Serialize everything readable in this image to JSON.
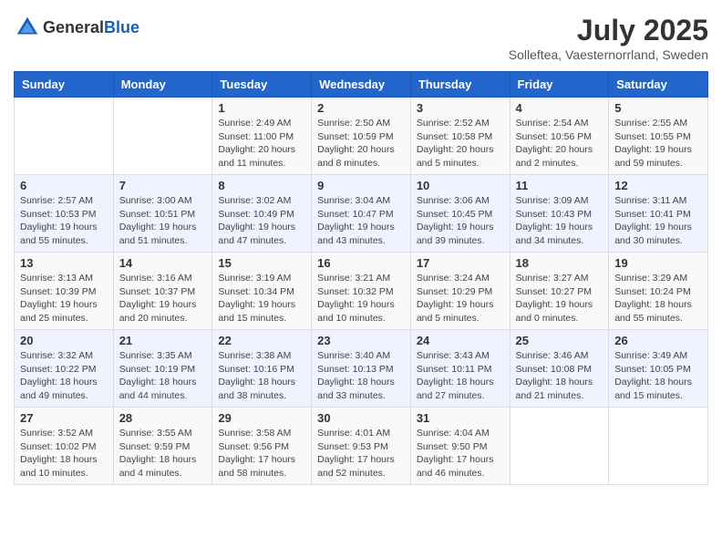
{
  "header": {
    "logo_general": "General",
    "logo_blue": "Blue",
    "month_year": "July 2025",
    "location": "Solleftea, Vaesternorrland, Sweden"
  },
  "weekdays": [
    "Sunday",
    "Monday",
    "Tuesday",
    "Wednesday",
    "Thursday",
    "Friday",
    "Saturday"
  ],
  "weeks": [
    [
      {
        "day": "",
        "info": ""
      },
      {
        "day": "",
        "info": ""
      },
      {
        "day": "1",
        "info": "Sunrise: 2:49 AM\nSunset: 11:00 PM\nDaylight: 20 hours\nand 11 minutes."
      },
      {
        "day": "2",
        "info": "Sunrise: 2:50 AM\nSunset: 10:59 PM\nDaylight: 20 hours\nand 8 minutes."
      },
      {
        "day": "3",
        "info": "Sunrise: 2:52 AM\nSunset: 10:58 PM\nDaylight: 20 hours\nand 5 minutes."
      },
      {
        "day": "4",
        "info": "Sunrise: 2:54 AM\nSunset: 10:56 PM\nDaylight: 20 hours\nand 2 minutes."
      },
      {
        "day": "5",
        "info": "Sunrise: 2:55 AM\nSunset: 10:55 PM\nDaylight: 19 hours\nand 59 minutes."
      }
    ],
    [
      {
        "day": "6",
        "info": "Sunrise: 2:57 AM\nSunset: 10:53 PM\nDaylight: 19 hours\nand 55 minutes."
      },
      {
        "day": "7",
        "info": "Sunrise: 3:00 AM\nSunset: 10:51 PM\nDaylight: 19 hours\nand 51 minutes."
      },
      {
        "day": "8",
        "info": "Sunrise: 3:02 AM\nSunset: 10:49 PM\nDaylight: 19 hours\nand 47 minutes."
      },
      {
        "day": "9",
        "info": "Sunrise: 3:04 AM\nSunset: 10:47 PM\nDaylight: 19 hours\nand 43 minutes."
      },
      {
        "day": "10",
        "info": "Sunrise: 3:06 AM\nSunset: 10:45 PM\nDaylight: 19 hours\nand 39 minutes."
      },
      {
        "day": "11",
        "info": "Sunrise: 3:09 AM\nSunset: 10:43 PM\nDaylight: 19 hours\nand 34 minutes."
      },
      {
        "day": "12",
        "info": "Sunrise: 3:11 AM\nSunset: 10:41 PM\nDaylight: 19 hours\nand 30 minutes."
      }
    ],
    [
      {
        "day": "13",
        "info": "Sunrise: 3:13 AM\nSunset: 10:39 PM\nDaylight: 19 hours\nand 25 minutes."
      },
      {
        "day": "14",
        "info": "Sunrise: 3:16 AM\nSunset: 10:37 PM\nDaylight: 19 hours\nand 20 minutes."
      },
      {
        "day": "15",
        "info": "Sunrise: 3:19 AM\nSunset: 10:34 PM\nDaylight: 19 hours\nand 15 minutes."
      },
      {
        "day": "16",
        "info": "Sunrise: 3:21 AM\nSunset: 10:32 PM\nDaylight: 19 hours\nand 10 minutes."
      },
      {
        "day": "17",
        "info": "Sunrise: 3:24 AM\nSunset: 10:29 PM\nDaylight: 19 hours\nand 5 minutes."
      },
      {
        "day": "18",
        "info": "Sunrise: 3:27 AM\nSunset: 10:27 PM\nDaylight: 19 hours\nand 0 minutes."
      },
      {
        "day": "19",
        "info": "Sunrise: 3:29 AM\nSunset: 10:24 PM\nDaylight: 18 hours\nand 55 minutes."
      }
    ],
    [
      {
        "day": "20",
        "info": "Sunrise: 3:32 AM\nSunset: 10:22 PM\nDaylight: 18 hours\nand 49 minutes."
      },
      {
        "day": "21",
        "info": "Sunrise: 3:35 AM\nSunset: 10:19 PM\nDaylight: 18 hours\nand 44 minutes."
      },
      {
        "day": "22",
        "info": "Sunrise: 3:38 AM\nSunset: 10:16 PM\nDaylight: 18 hours\nand 38 minutes."
      },
      {
        "day": "23",
        "info": "Sunrise: 3:40 AM\nSunset: 10:13 PM\nDaylight: 18 hours\nand 33 minutes."
      },
      {
        "day": "24",
        "info": "Sunrise: 3:43 AM\nSunset: 10:11 PM\nDaylight: 18 hours\nand 27 minutes."
      },
      {
        "day": "25",
        "info": "Sunrise: 3:46 AM\nSunset: 10:08 PM\nDaylight: 18 hours\nand 21 minutes."
      },
      {
        "day": "26",
        "info": "Sunrise: 3:49 AM\nSunset: 10:05 PM\nDaylight: 18 hours\nand 15 minutes."
      }
    ],
    [
      {
        "day": "27",
        "info": "Sunrise: 3:52 AM\nSunset: 10:02 PM\nDaylight: 18 hours\nand 10 minutes."
      },
      {
        "day": "28",
        "info": "Sunrise: 3:55 AM\nSunset: 9:59 PM\nDaylight: 18 hours\nand 4 minutes."
      },
      {
        "day": "29",
        "info": "Sunrise: 3:58 AM\nSunset: 9:56 PM\nDaylight: 17 hours\nand 58 minutes."
      },
      {
        "day": "30",
        "info": "Sunrise: 4:01 AM\nSunset: 9:53 PM\nDaylight: 17 hours\nand 52 minutes."
      },
      {
        "day": "31",
        "info": "Sunrise: 4:04 AM\nSunset: 9:50 PM\nDaylight: 17 hours\nand 46 minutes."
      },
      {
        "day": "",
        "info": ""
      },
      {
        "day": "",
        "info": ""
      }
    ]
  ]
}
